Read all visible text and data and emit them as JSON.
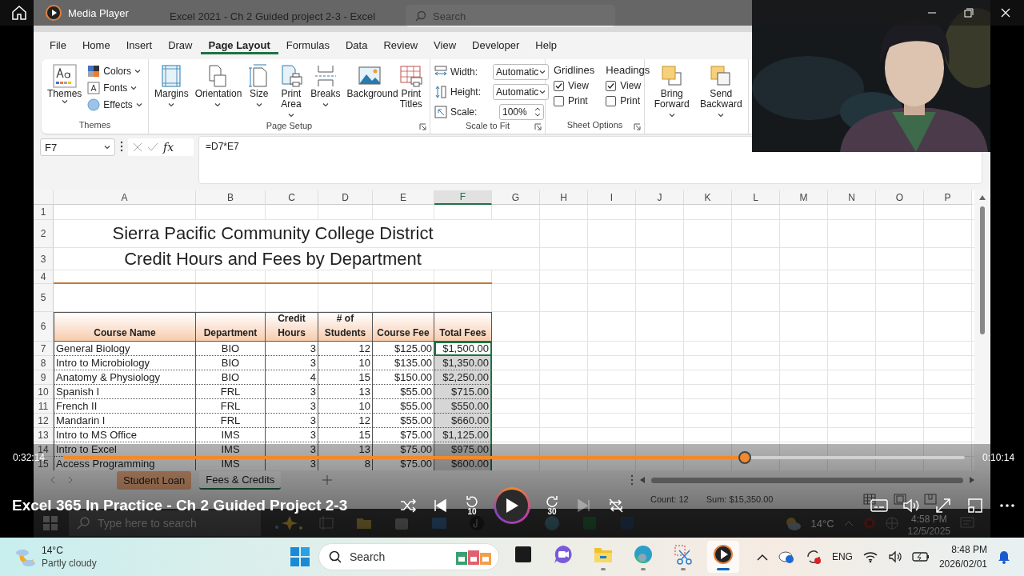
{
  "player": {
    "title": "Media Player",
    "video_title": "Excel 365 In Practice - Ch 2 Guided Project 2-3",
    "elapsed": "0:32:14",
    "remaining": "0:10:14",
    "progress": {
      "level": 0.756
    },
    "controls": [
      {
        "kind": "shuffle",
        "disabled": false
      },
      {
        "kind": "previous",
        "disabled": false
      },
      {
        "kind": "rewind",
        "label": "10",
        "disabled": false
      },
      {
        "kind": "play",
        "disabled": false
      },
      {
        "kind": "forward",
        "label": "30",
        "disabled": false
      },
      {
        "kind": "next",
        "disabled": true
      },
      {
        "kind": "repeat",
        "disabled": false
      }
    ],
    "extra_controls": [
      {
        "kind": "captions"
      },
      {
        "kind": "volume"
      },
      {
        "kind": "fullscreen"
      },
      {
        "kind": "miniplayer"
      },
      {
        "kind": "more"
      }
    ]
  },
  "excel": {
    "title": "Excel 2021 - Ch 2 Guided project 2-3  -  Excel",
    "search_placeholder": "Search",
    "ribbon_tabs": [
      {
        "label": "File",
        "selected": false
      },
      {
        "label": "Home",
        "selected": false
      },
      {
        "label": "Insert",
        "selected": false
      },
      {
        "label": "Draw",
        "selected": false
      },
      {
        "label": "Page Layout",
        "selected": true
      },
      {
        "label": "Formulas",
        "selected": false
      },
      {
        "label": "Data",
        "selected": false
      },
      {
        "label": "Review",
        "selected": false
      },
      {
        "label": "View",
        "selected": false
      },
      {
        "label": "Developer",
        "selected": false
      },
      {
        "label": "Help",
        "selected": false
      }
    ],
    "ribbon_groups": [
      {
        "kind": "themes",
        "label": "Themes",
        "launcher": false,
        "big": {
          "label": "Themes"
        },
        "items": [
          {
            "kind": "colors",
            "label": "Colors"
          },
          {
            "kind": "fonts",
            "label": "Fonts"
          },
          {
            "kind": "effects",
            "label": "Effects"
          }
        ]
      },
      {
        "kind": "buttons",
        "label": "Page Setup",
        "launcher": true,
        "buttons": [
          {
            "kind": "margins",
            "label": "Margins",
            "dropdown": true
          },
          {
            "kind": "orientation",
            "label": "Orientation",
            "dropdown": true
          },
          {
            "kind": "size",
            "label": "Size",
            "dropdown": true
          },
          {
            "kind": "print-area",
            "label": "Print Area",
            "dropdown": true
          },
          {
            "kind": "breaks",
            "label": "Breaks",
            "dropdown": true
          },
          {
            "kind": "background",
            "label": "Background",
            "dropdown": false
          },
          {
            "kind": "print-titles",
            "label": "Print Titles",
            "dropdown": false
          }
        ]
      },
      {
        "kind": "scale",
        "label": "Scale to Fit",
        "launcher": true,
        "fields": [
          {
            "kind": "select",
            "label": "Width:",
            "value": "Automatic"
          },
          {
            "kind": "select",
            "label": "Height:",
            "value": "Automatic"
          },
          {
            "kind": "spin",
            "label": "Scale:",
            "value": "100%"
          }
        ]
      },
      {
        "kind": "checks",
        "label": "Sheet Options",
        "launcher": true,
        "columns": [
          {
            "title": "Gridlines",
            "items": [
              {
                "label": "View",
                "checked": true
              },
              {
                "label": "Print",
                "checked": false
              }
            ]
          },
          {
            "title": "Headings",
            "items": [
              {
                "label": "View",
                "checked": true
              },
              {
                "label": "Print",
                "checked": false
              }
            ]
          }
        ]
      },
      {
        "kind": "buttons",
        "launcher": false,
        "buttons": [
          {
            "kind": "bring-forward",
            "label": "Bring Forward",
            "dropdown": true
          },
          {
            "kind": "send-backward",
            "label": "Send Backward",
            "dropdown": true
          }
        ]
      }
    ],
    "name_box": "F7",
    "formula": "=D7*E7",
    "fx": "fx",
    "columns": [
      {
        "label": "A",
        "selected": false
      },
      {
        "label": "B",
        "selected": false
      },
      {
        "label": "C",
        "selected": false
      },
      {
        "label": "D",
        "selected": false
      },
      {
        "label": "E",
        "selected": false
      },
      {
        "label": "F",
        "selected": true
      },
      {
        "label": "G",
        "selected": false
      },
      {
        "label": "H",
        "selected": false
      },
      {
        "label": "I",
        "selected": false
      },
      {
        "label": "J",
        "selected": false
      },
      {
        "label": "K",
        "selected": false
      },
      {
        "label": "L",
        "selected": false
      },
      {
        "label": "M",
        "selected": false
      },
      {
        "label": "N",
        "selected": false
      },
      {
        "label": "O",
        "selected": false
      },
      {
        "label": "P",
        "selected": false
      }
    ],
    "rows": [
      {
        "number": "1",
        "kind": "blank"
      },
      {
        "number": "2",
        "kind": "title",
        "text": "Sierra Pacific Community College District"
      },
      {
        "number": "3",
        "kind": "title",
        "text": "Credit Hours and Fees by Department"
      },
      {
        "number": "4",
        "kind": "rule"
      },
      {
        "number": "5",
        "kind": "blank"
      },
      {
        "number": "6",
        "kind": "header",
        "cells": [
          "Course Name",
          "Department",
          "Credit Hours",
          "# of Students",
          "Course Fee",
          "Total Fees"
        ]
      },
      {
        "number": "7",
        "kind": "data",
        "selected": false,
        "active": true,
        "cells": [
          "General Biology",
          "BIO",
          "3",
          "12",
          "$125.00",
          "$1,500.00"
        ]
      },
      {
        "number": "8",
        "kind": "data",
        "selected": true,
        "active": false,
        "cells": [
          "Intro to Microbiology",
          "BIO",
          "3",
          "10",
          "$135.00",
          "$1,350.00"
        ]
      },
      {
        "number": "9",
        "kind": "data",
        "selected": true,
        "active": false,
        "cells": [
          "Anatomy & Physiology",
          "BIO",
          "4",
          "15",
          "$150.00",
          "$2,250.00"
        ]
      },
      {
        "number": "10",
        "kind": "data",
        "selected": true,
        "active": false,
        "cells": [
          "Spanish I",
          "FRL",
          "3",
          "13",
          "$55.00",
          "$715.00"
        ]
      },
      {
        "number": "11",
        "kind": "data",
        "selected": true,
        "active": false,
        "cells": [
          "French II",
          "FRL",
          "3",
          "10",
          "$55.00",
          "$550.00"
        ]
      },
      {
        "number": "12",
        "kind": "data",
        "selected": true,
        "active": false,
        "cells": [
          "Mandarin I",
          "FRL",
          "3",
          "12",
          "$55.00",
          "$660.00"
        ]
      },
      {
        "number": "13",
        "kind": "data",
        "selected": true,
        "active": false,
        "cells": [
          "Intro to MS Office",
          "IMS",
          "3",
          "15",
          "$75.00",
          "$1,125.00"
        ]
      },
      {
        "number": "14",
        "kind": "data",
        "selected": true,
        "active": false,
        "cells": [
          "Intro to Excel",
          "IMS",
          "3",
          "13",
          "$75.00",
          "$975.00"
        ]
      },
      {
        "number": "15",
        "kind": "data",
        "selected": true,
        "active": false,
        "cells": [
          "Access Programming",
          "IMS",
          "3",
          "8",
          "$75.00",
          "$600.00"
        ]
      }
    ],
    "sheet_tabs": [
      {
        "label": "Student Loan",
        "selected": false
      },
      {
        "label": "Fees & Credits",
        "selected": true
      }
    ],
    "status": [
      "Count: 12",
      "Sum: $15,350.00"
    ],
    "taskbar": {
      "search_placeholder": "Type here to search",
      "temperature": "14°C",
      "time": "4:58 PM",
      "date": "12/5/2025"
    }
  },
  "taskbar": {
    "temperature": "14°C",
    "condition": "Partly cloudy",
    "search_placeholder": "Search",
    "language": "ENG",
    "time": "8:48 PM",
    "date": "2026/02/01",
    "apps": [
      {
        "kind": "terminal",
        "running": false,
        "active": false
      },
      {
        "kind": "meet",
        "running": false,
        "active": false
      },
      {
        "kind": "folder",
        "running": true,
        "active": false
      },
      {
        "kind": "edge",
        "running": true,
        "active": false
      },
      {
        "kind": "snip",
        "running": true,
        "active": false
      },
      {
        "kind": "player",
        "running": true,
        "active": true
      }
    ]
  }
}
